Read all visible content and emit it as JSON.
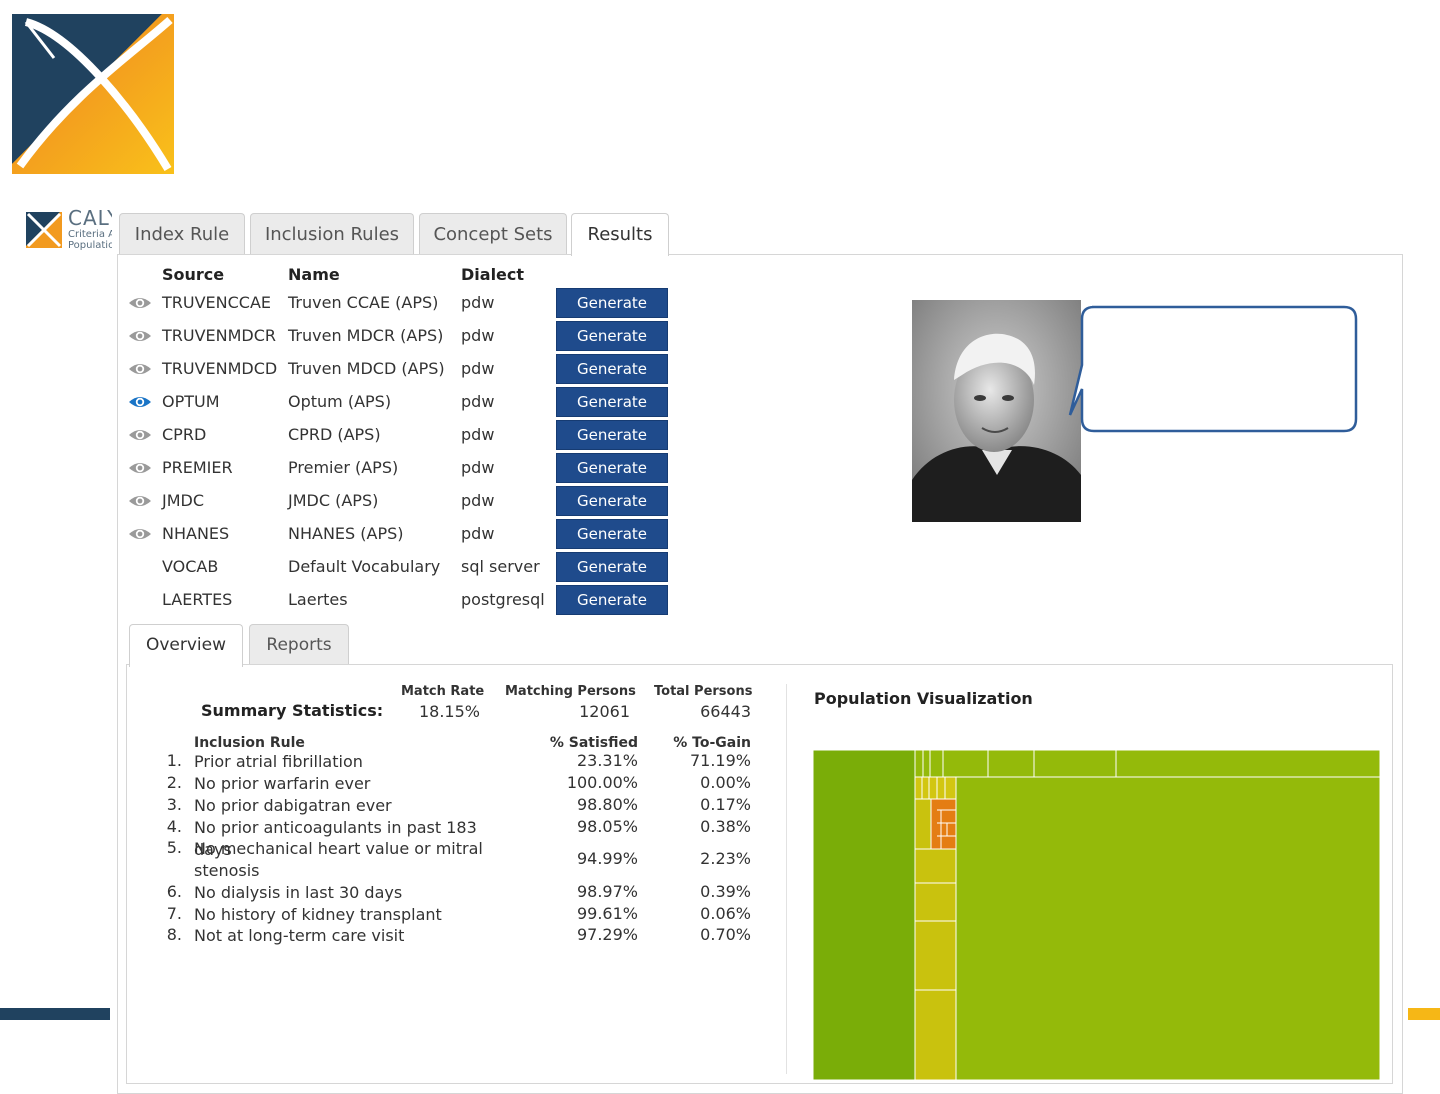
{
  "app": {
    "logo_name": "CALYPSO",
    "logo_sub_1": "Criteria Assessment",
    "logo_sub_2": "Population"
  },
  "tabs": [
    "Index Rule",
    "Inclusion Rules",
    "Concept Sets",
    "Results"
  ],
  "sources": {
    "headers": {
      "source": "Source",
      "name": "Name",
      "dialect": "Dialect"
    },
    "rows": [
      {
        "source": "TRUVENCCAE",
        "name": "Truven CCAE (APS)",
        "dialect": "pdw",
        "eye": "gray"
      },
      {
        "source": "TRUVENMDCR",
        "name": "Truven MDCR (APS)",
        "dialect": "pdw",
        "eye": "gray"
      },
      {
        "source": "TRUVENMDCD",
        "name": "Truven MDCD (APS)",
        "dialect": "pdw",
        "eye": "gray"
      },
      {
        "source": "OPTUM",
        "name": "Optum (APS)",
        "dialect": "pdw",
        "eye": "blue"
      },
      {
        "source": "CPRD",
        "name": "CPRD (APS)",
        "dialect": "pdw",
        "eye": "gray"
      },
      {
        "source": "PREMIER",
        "name": "Premier (APS)",
        "dialect": "pdw",
        "eye": "gray"
      },
      {
        "source": "JMDC",
        "name": "JMDC (APS)",
        "dialect": "pdw",
        "eye": "gray"
      },
      {
        "source": "NHANES",
        "name": "NHANES (APS)",
        "dialect": "pdw",
        "eye": "gray"
      },
      {
        "source": "VOCAB",
        "name": "Default Vocabulary",
        "dialect": "sql server",
        "eye": "none"
      },
      {
        "source": "LAERTES",
        "name": "Laertes",
        "dialect": "postgresql",
        "eye": "none"
      }
    ],
    "generate_label": "Generate"
  },
  "subtabs": [
    "Overview",
    "Reports"
  ],
  "summary": {
    "label": "Summary Statistics:",
    "match_rate_head": "Match Rate",
    "matching_head": "Matching Persons",
    "total_head": "Total Persons",
    "match_rate": "18.15%",
    "matching": "12061",
    "total": "66443"
  },
  "rules": {
    "head_rule": "Inclusion Rule",
    "head_sat": "% Satisfied",
    "head_gain": "% To-Gain",
    "rows": [
      {
        "idx": "1.",
        "text": "Prior atrial fibrillation",
        "sat": "23.31%",
        "gain": "71.19%"
      },
      {
        "idx": "2.",
        "text": "No prior warfarin ever",
        "sat": "100.00%",
        "gain": "0.00%"
      },
      {
        "idx": "3.",
        "text": "No prior dabigatran ever",
        "sat": "98.80%",
        "gain": "0.17%"
      },
      {
        "idx": "4.",
        "text": "No prior anticoagulants in past 183 days",
        "sat": "98.05%",
        "gain": "0.38%"
      },
      {
        "idx": "5.",
        "text": "No mechanical heart value or mitral stenosis",
        "sat": "94.99%",
        "gain": "2.23%"
      },
      {
        "idx": "6.",
        "text": "No dialysis in last 30 days",
        "sat": "98.97%",
        "gain": "0.39%"
      },
      {
        "idx": "7.",
        "text": "No history of kidney transplant",
        "sat": "99.61%",
        "gain": "0.06%"
      },
      {
        "idx": "8.",
        "text": "Not at long-term care visit",
        "sat": "97.29%",
        "gain": "0.70%"
      }
    ]
  },
  "visualization": {
    "title": "Population Visualization"
  },
  "colors": {
    "brand_navy": "#20425f",
    "brand_orange": "#f08a24",
    "brand_yellow": "#f6b716",
    "button_blue": "#1f4b8c",
    "eye_active": "#1a74c6",
    "treemap_dark_green": "#7aad08",
    "treemap_green": "#94ba0a",
    "treemap_yellow": "#c9c20e",
    "treemap_orange": "#e47d13"
  }
}
